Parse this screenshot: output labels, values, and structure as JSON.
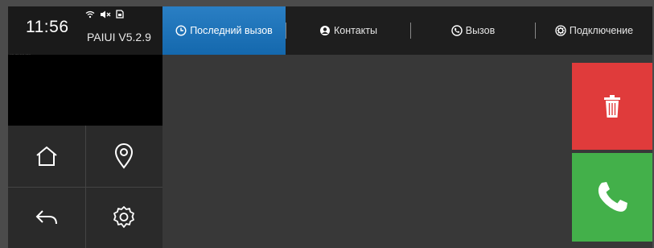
{
  "status": {
    "time": "11:56",
    "version": "PAIUI V5.2.9",
    "icons": [
      "wifi-icon",
      "speaker-muted-icon",
      "sd-card-icon"
    ]
  },
  "preview": {
    "caption": "···· ···· ···· ·····"
  },
  "tabs": [
    {
      "label": "Последний вызов",
      "icon": "clock-icon",
      "active": true
    },
    {
      "label": "Контакты",
      "icon": "contact-icon",
      "active": false
    },
    {
      "label": "Вызов",
      "icon": "phone-icon",
      "active": false
    },
    {
      "label": "Подключение",
      "icon": "gear-icon",
      "active": false
    }
  ],
  "nav": [
    "home-icon",
    "location-icon",
    "back-icon",
    "settings-icon"
  ],
  "actions": {
    "delete_icon": "trash-icon",
    "call_icon": "phone-icon"
  },
  "colors": {
    "active_tab": "#1c74bd",
    "delete": "#e03b3b",
    "call": "#43b04a",
    "background": "#383838"
  }
}
